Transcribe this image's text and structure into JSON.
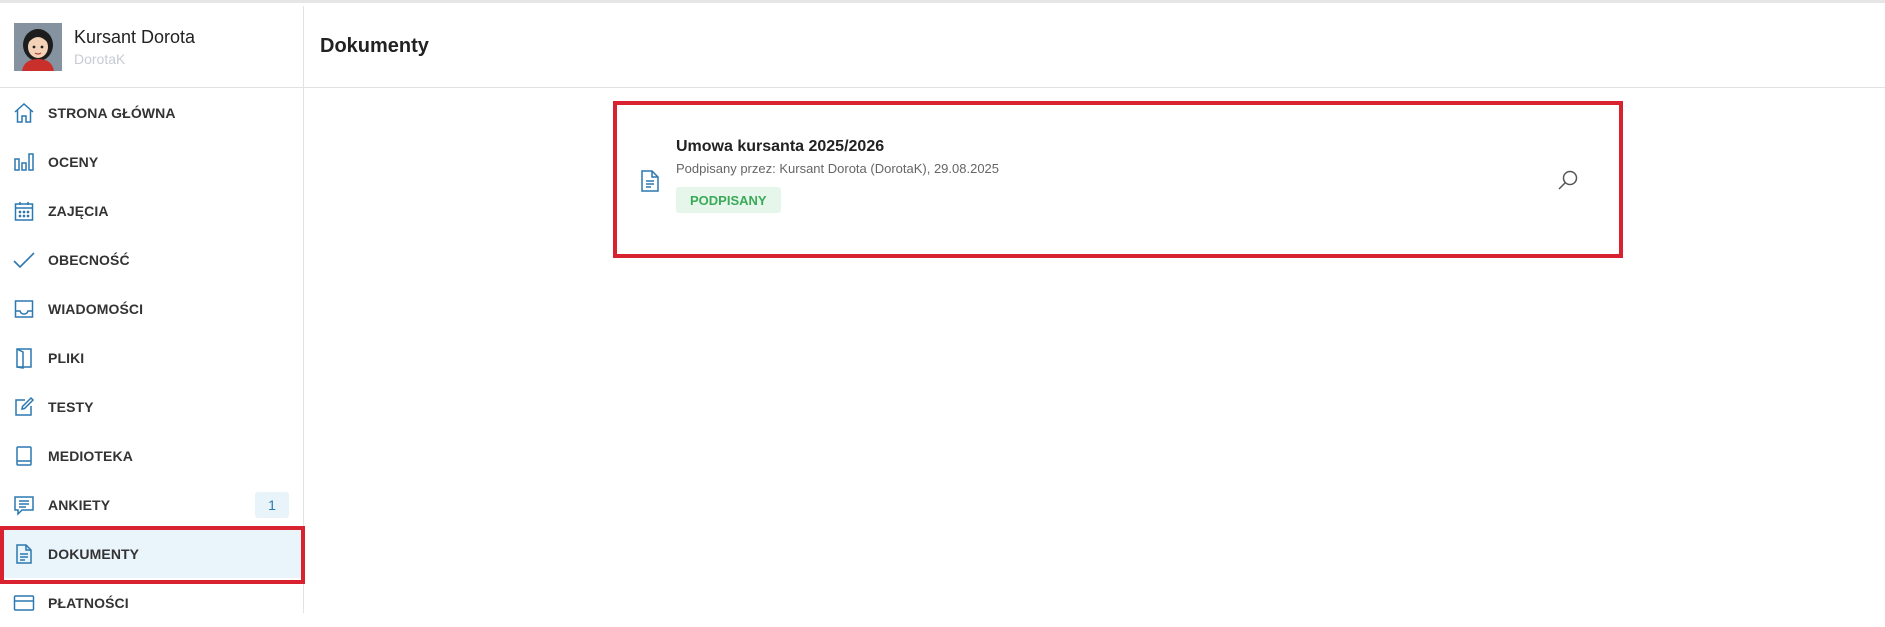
{
  "profile": {
    "name": "Kursant Dorota",
    "username": "DorotaK"
  },
  "header": {
    "title": "Dokumenty"
  },
  "colors": {
    "accent": "#2b79b0",
    "highlight": "#d9222f",
    "active_bg": "#eaf5fb",
    "status_green": "#3aaa59"
  },
  "sidebar": {
    "items": [
      {
        "label": "STRONA GŁÓWNA",
        "icon": "home-icon"
      },
      {
        "label": "OCENY",
        "icon": "bar-chart-icon"
      },
      {
        "label": "ZAJĘCIA",
        "icon": "calendar-icon"
      },
      {
        "label": "OBECNOŚĆ",
        "icon": "checkmark-icon"
      },
      {
        "label": "WIADOMOŚCI",
        "icon": "inbox-icon"
      },
      {
        "label": "PLIKI",
        "icon": "folder-icon"
      },
      {
        "label": "TESTY",
        "icon": "edit-icon"
      },
      {
        "label": "MEDIOTEKA",
        "icon": "book-icon"
      },
      {
        "label": "ANKIETY",
        "icon": "survey-icon",
        "badge": "1"
      },
      {
        "label": "DOKUMENTY",
        "icon": "document-icon",
        "active": true
      },
      {
        "label": "PŁATNOŚCI",
        "icon": "credit-card-icon"
      }
    ]
  },
  "document": {
    "title": "Umowa kursanta 2025/2026",
    "signed_by": "Podpisany przez: Kursant Dorota (DorotaK), 29.08.2025",
    "status": "PODPISANY",
    "icon": "document-icon",
    "action_icon": "search-icon"
  }
}
